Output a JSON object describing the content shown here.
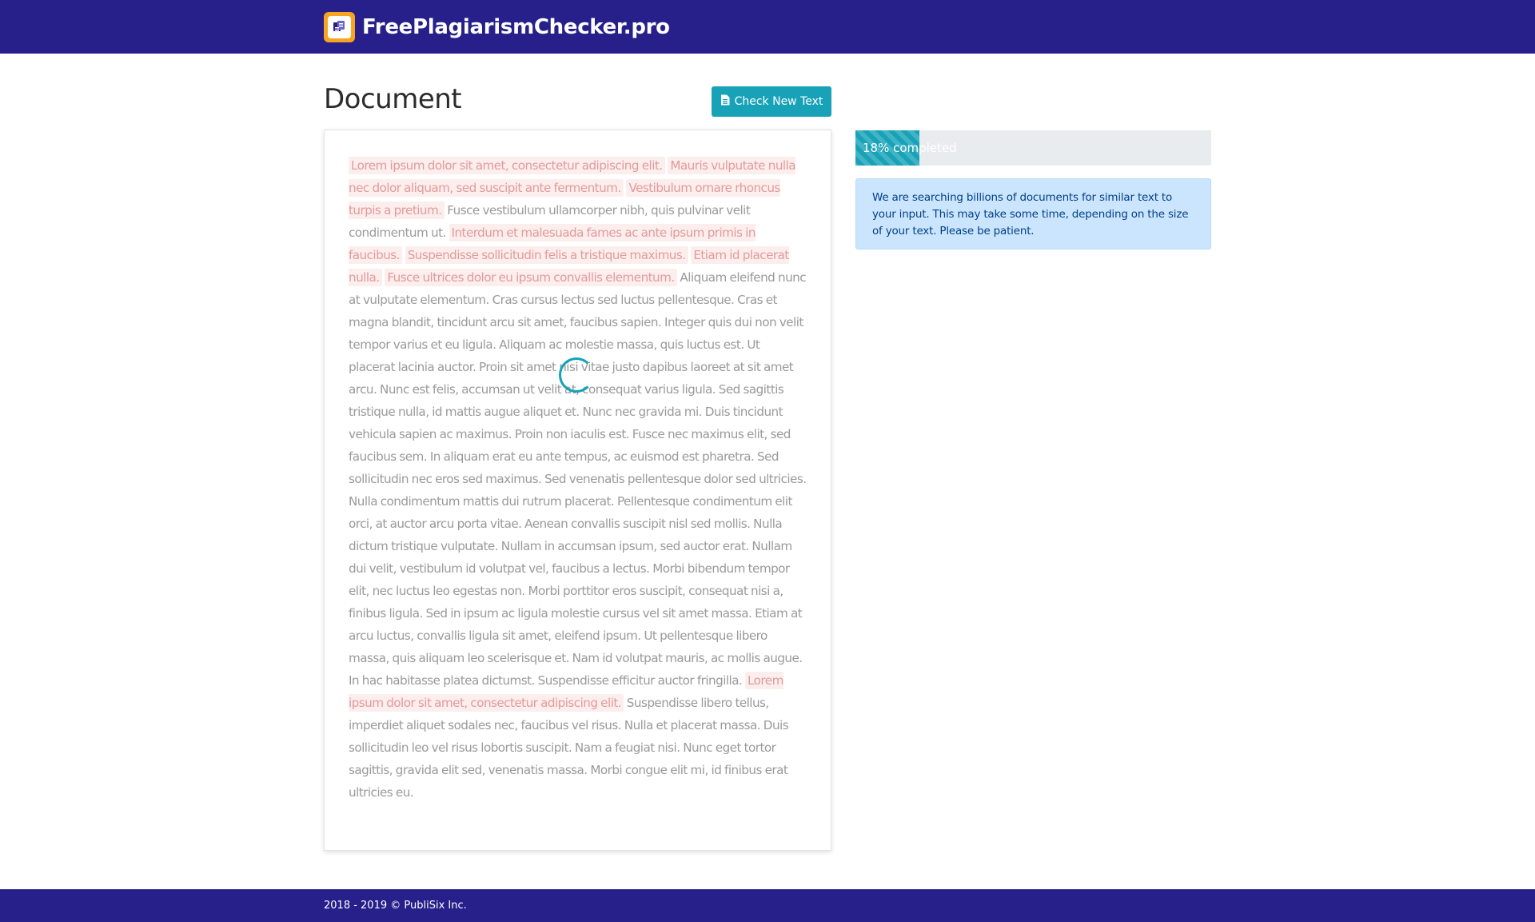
{
  "header": {
    "brand_name": "FreePlagiarismChecker.pro",
    "logo_icon": "document-icon",
    "background_color": "#27208a",
    "logo_color": "#f7a520"
  },
  "document": {
    "title": "Document",
    "check_button_label": "Check New Text",
    "check_button_icon": "file-text-icon",
    "segments": [
      {
        "text": "Lorem ipsum dolor sit amet, consectetur adipiscing elit.",
        "highlighted": true
      },
      {
        "text": " ",
        "highlighted": false
      },
      {
        "text": "Mauris vulputate nulla nec dolor aliquam, sed suscipit ante fermentum.",
        "highlighted": true
      },
      {
        "text": " ",
        "highlighted": false
      },
      {
        "text": "Vestibulum ornare rhoncus turpis a pretium.",
        "highlighted": true
      },
      {
        "text": " Fusce vestibulum ullamcorper nibh, quis pulvinar velit condimentum ut. ",
        "highlighted": false
      },
      {
        "text": "Interdum et malesuada fames ac ante ipsum primis in faucibus.",
        "highlighted": true
      },
      {
        "text": " ",
        "highlighted": false
      },
      {
        "text": "Suspendisse sollicitudin felis a tristique maximus.",
        "highlighted": true
      },
      {
        "text": " ",
        "highlighted": false
      },
      {
        "text": "Etiam id placerat nulla.",
        "highlighted": true
      },
      {
        "text": " ",
        "highlighted": false
      },
      {
        "text": "Fusce ultrices dolor eu ipsum convallis elementum.",
        "highlighted": true
      },
      {
        "text": " Aliquam eleifend nunc at vulputate elementum. Cras cursus lectus sed luctus pellentesque. Cras et magna blandit, tincidunt arcu sit amet, faucibus sapien. Integer quis dui non velit tempor varius et eu ligula. Aliquam ac molestie massa, quis luctus est. Ut placerat lacinia auctor. Proin sit amet nisi vitae justo dapibus laoreet at sit amet arcu. Nunc est felis, accumsan ut velit at, consequat varius ligula. Sed sagittis tristique nulla, id mattis augue aliquet et. Nunc nec gravida mi. Duis tincidunt vehicula sapien ac maximus. Proin non iaculis est. Fusce nec maximus elit, sed faucibus sem. In aliquam erat eu ante tempus, ac euismod est pharetra. Sed sollicitudin nec eros sed maximus. Sed venenatis pellentesque dolor sed ultricies. Nulla condimentum mattis dui rutrum placerat. Pellentesque condimentum elit orci, at auctor arcu porta vitae. Aenean convallis suscipit nisl sed mollis. Nulla dictum tristique vulputate. Nullam in accumsan ipsum, sed auctor erat. Nullam dui velit, vestibulum id volutpat vel, faucibus a lectus. Morbi bibendum tempor elit, nec luctus leo egestas non. Morbi porttitor eros suscipit, consequat nisi a, finibus ligula. Sed in ipsum ac ligula molestie cursus vel sit amet massa. Etiam at arcu luctus, convallis ligula sit amet, eleifend ipsum. Ut pellentesque libero massa, quis aliquam leo scelerisque et. Nam id volutpat mauris, ac mollis augue. In hac habitasse platea dictumst. Suspendisse efficitur auctor fringilla. ",
        "highlighted": false
      },
      {
        "text": "Lorem ipsum dolor sit amet, consectetur adipiscing elit.",
        "highlighted": true
      },
      {
        "text": " Suspendisse libero tellus, imperdiet aliquet sodales nec, faucibus vel risus. Nulla et placerat massa. Duis sollicitudin leo vel risus lobortis suscipit. Nam a feugiat nisi. Nunc eget tortor sagittis, gravida elit sed, venenatis massa. Morbi congue elit mi, id finibus erat ultricies eu.",
        "highlighted": false
      }
    ],
    "highlight_color": "#fdeeee",
    "loading_icon": "spinner-icon"
  },
  "progress": {
    "percent": 18,
    "label": "18% completed",
    "color": "#17a2b8"
  },
  "alert": {
    "message": "We are searching billions of documents for similar text to your input. This may take some time, depending on the size of your text. Please be patient."
  },
  "footer": {
    "text": "2018 - 2019 © PubliSix Inc."
  }
}
